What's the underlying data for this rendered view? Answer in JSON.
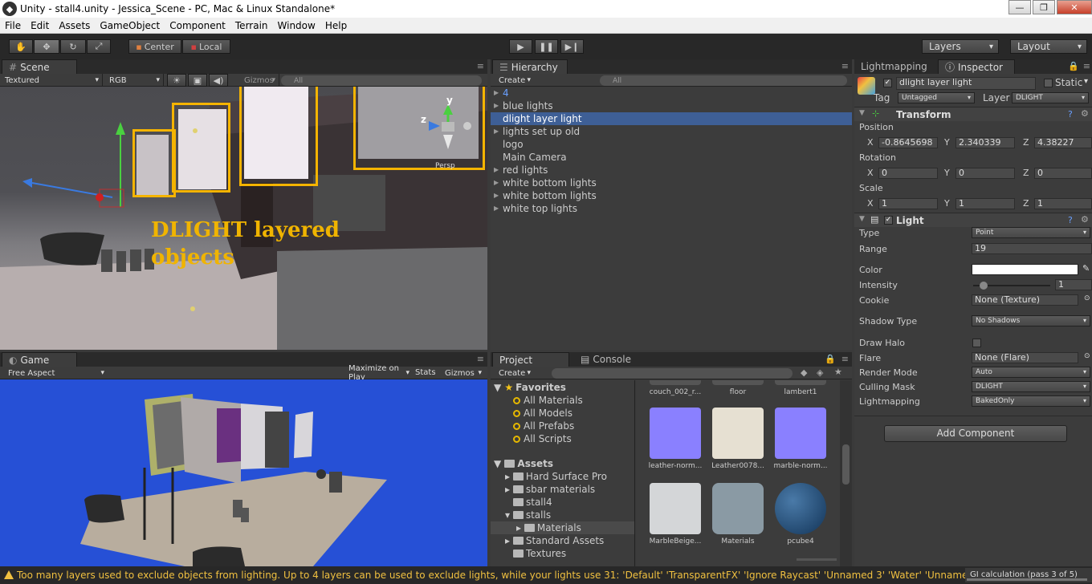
{
  "window": {
    "title": "Unity - stall4.unity - Jessica_Scene - PC, Mac & Linux Standalone*"
  },
  "menu": [
    "File",
    "Edit",
    "Assets",
    "GameObject",
    "Component",
    "Terrain",
    "Window",
    "Help"
  ],
  "toolbar": {
    "center": "Center",
    "local": "Local",
    "layers": "Layers",
    "layout": "Layout"
  },
  "scene": {
    "tab": "Scene",
    "render_mode": "Textured",
    "color_mode": "RGB",
    "gizmos": "Gizmos",
    "search": "All",
    "persp": "Persp",
    "overlay_line1": "DLIGHT layered",
    "overlay_line2": "objects"
  },
  "game": {
    "tab": "Game",
    "aspect": "Free Aspect",
    "maximize": "Maximize on Play",
    "stats": "Stats",
    "gizmos": "Gizmos"
  },
  "hierarchy": {
    "tab": "Hierarchy",
    "create": "Create",
    "search": "All",
    "items": [
      {
        "label": "4",
        "expandable": true,
        "blue": true
      },
      {
        "label": "blue lights",
        "expandable": true
      },
      {
        "label": "dlight layer light",
        "selected": true
      },
      {
        "label": "lights set up old",
        "expandable": true
      },
      {
        "label": "logo"
      },
      {
        "label": "Main Camera"
      },
      {
        "label": "red lights",
        "expandable": true
      },
      {
        "label": "white bottom lights",
        "expandable": true
      },
      {
        "label": "white bottom lights",
        "expandable": true
      },
      {
        "label": "white top lights",
        "expandable": true
      }
    ]
  },
  "inspector": {
    "tab_lightmapping": "Lightmapping",
    "tab_inspector": "Inspector",
    "object_name": "dlight layer light",
    "static_label": "Static",
    "tag_label": "Tag",
    "tag_value": "Untagged",
    "layer_label": "Layer",
    "layer_value": "DLIGHT",
    "transform": {
      "title": "Transform",
      "position_label": "Position",
      "position": {
        "x": "-0.8645698",
        "y": "2.340339",
        "z": "4.38227"
      },
      "rotation_label": "Rotation",
      "rotation": {
        "x": "0",
        "y": "0",
        "z": "0"
      },
      "scale_label": "Scale",
      "scale": {
        "x": "1",
        "y": "1",
        "z": "1"
      },
      "x": "X",
      "y": "Y",
      "z": "Z"
    },
    "light": {
      "title": "Light",
      "type_label": "Type",
      "type_value": "Point",
      "range_label": "Range",
      "range_value": "19",
      "color_label": "Color",
      "color_value": "#ffffff",
      "intensity_label": "Intensity",
      "intensity_value": "1",
      "cookie_label": "Cookie",
      "cookie_value": "None (Texture)",
      "shadow_label": "Shadow Type",
      "shadow_value": "No Shadows",
      "halo_label": "Draw Halo",
      "flare_label": "Flare",
      "flare_value": "None (Flare)",
      "render_label": "Render Mode",
      "render_value": "Auto",
      "culling_label": "Culling Mask",
      "culling_value": "DLIGHT",
      "lightmapping_label": "Lightmapping",
      "lightmapping_value": "BakedOnly"
    },
    "add_component": "Add Component"
  },
  "project": {
    "tab": "Project",
    "console_tab": "Console",
    "create": "Create",
    "favorites": "Favorites",
    "favorite_items": [
      "All Materials",
      "All Models",
      "All Prefabs",
      "All Scripts"
    ],
    "assets": "Assets",
    "asset_folders": [
      "Hard Surface Pro",
      "sbar materials",
      "stall4",
      "stalls",
      "Materials",
      "Standard Assets",
      "Textures"
    ],
    "grid_top": [
      "couch_002_r...",
      "floor",
      "lambert1"
    ],
    "grid_mid": [
      "leather-norm...",
      "Leather0078...",
      "marble-norm..."
    ],
    "grid_bot": [
      "MarbleBeige...",
      "Materials",
      "pcube4"
    ]
  },
  "status": {
    "message": "Too many layers used to exclude objects from lighting. Up to 4 layers can be used to exclude lights, while your lights use 31: 'Default' 'TransparentFX' 'Ignore Raycast' 'Unnamed 3' 'Water' 'Unnamed 5' 'Unnamed",
    "gi": "GI calculation (pass 3 of 5)"
  }
}
